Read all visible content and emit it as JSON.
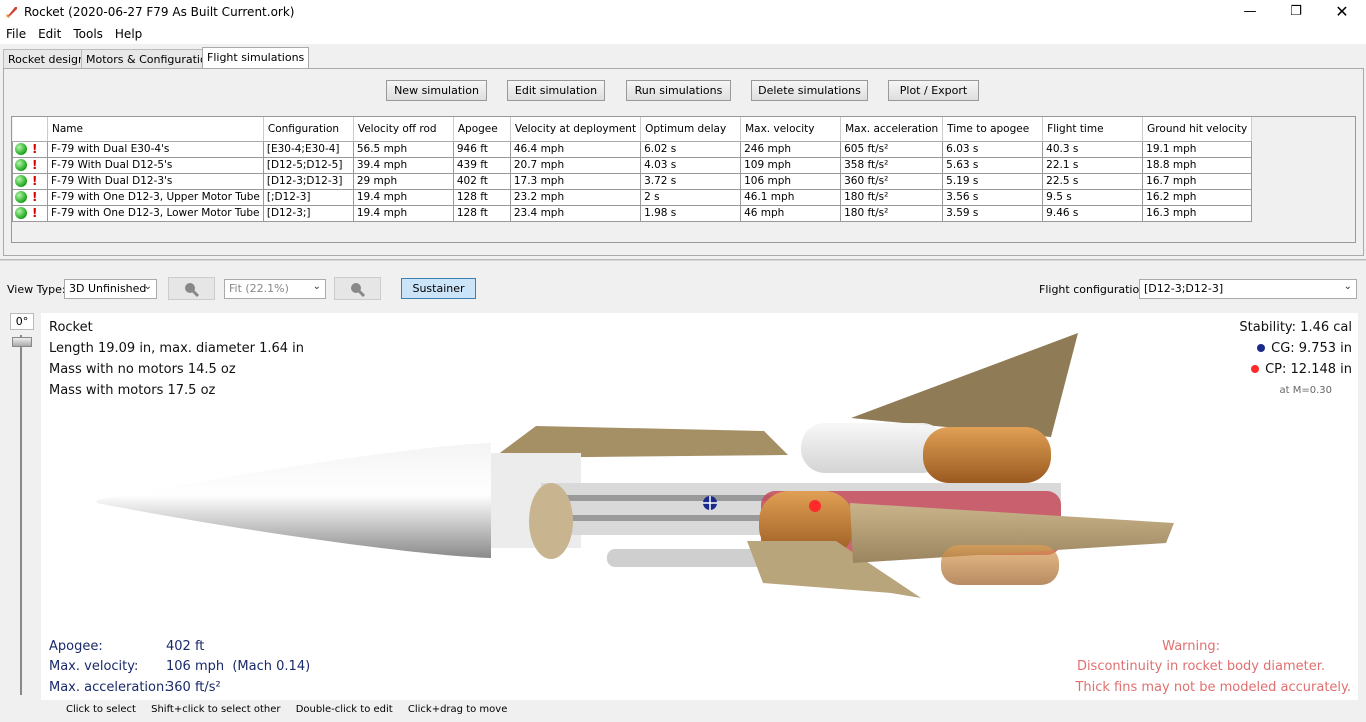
{
  "window": {
    "title": "Rocket (2020-06-27 F79 As Built Current.ork)"
  },
  "menu": [
    "File",
    "Edit",
    "Tools",
    "Help"
  ],
  "tabs": [
    "Rocket design",
    "Motors & Configuration",
    "Flight simulations"
  ],
  "buttons": {
    "new_sim": "New simulation",
    "edit_sim": "Edit simulation",
    "run_sims": "Run simulations",
    "delete_sims": "Delete simulations",
    "plot_export": "Plot / Export"
  },
  "table": {
    "columns": [
      "Name",
      "Configuration",
      "Velocity off rod",
      "Apogee",
      "Velocity at deployment",
      "Optimum delay",
      "Max. velocity",
      "Max. acceleration",
      "Time to apogee",
      "Flight time",
      "Ground hit velocity"
    ],
    "rows": [
      [
        "F-79 with Dual E30-4's",
        "[E30-4;E30-4]",
        "56.5 mph",
        "946 ft",
        "46.4 mph",
        "6.02 s",
        "246 mph",
        "605 ft/s²",
        "6.03 s",
        "40.3 s",
        "19.1 mph"
      ],
      [
        "F-79 With Dual D12-5's",
        "[D12-5;D12-5]",
        "39.4 mph",
        "439 ft",
        "20.7 mph",
        "4.03 s",
        "109 mph",
        "358 ft/s²",
        "5.63 s",
        "22.1 s",
        "18.8 mph"
      ],
      [
        "F-79 With Dual D12-3's",
        "[D12-3;D12-3]",
        "29 mph",
        "402 ft",
        "17.3 mph",
        "3.72 s",
        "106 mph",
        "360 ft/s²",
        "5.19 s",
        "22.5 s",
        "16.7 mph"
      ],
      [
        "F-79 with One D12-3, Upper Motor Tube",
        "[;D12-3]",
        "19.4 mph",
        "128 ft",
        "23.2 mph",
        "2 s",
        "46.1 mph",
        "180 ft/s²",
        "3.56 s",
        "9.5 s",
        "16.2 mph"
      ],
      [
        "F-79 with One D12-3, Lower Motor Tube",
        "[D12-3;]",
        "19.4 mph",
        "128 ft",
        "23.4 mph",
        "1.98 s",
        "46 mph",
        "180 ft/s²",
        "3.59 s",
        "9.46 s",
        "16.3 mph"
      ]
    ]
  },
  "toolbar": {
    "view_type_label": "View Type:",
    "view_type_value": "3D Unfinished",
    "zoom_value": "Fit (22.1%)",
    "sustainer_label": "Sustainer",
    "flight_config_label": "Flight configuration:",
    "flight_config_value": "[D12-3;D12-3]"
  },
  "rotation": "0°",
  "rocket_info": {
    "name": "Rocket",
    "length": "Length 19.09 in, max. diameter 1.64 in",
    "mass_no_motors": "Mass with no motors 14.5 oz",
    "mass_motors": "Mass with motors 17.5 oz"
  },
  "stability": {
    "stability": "Stability:  1.46 cal",
    "cg": "CG:  9.753 in",
    "cp": "CP: 12.148 in",
    "mach": "at M=0.30"
  },
  "flight_summary": {
    "apogee_label": "Apogee:",
    "apogee_value": "402 ft",
    "maxvel_label": "Max. velocity:",
    "maxvel_value": "106 mph  (Mach 0.14)",
    "maxacc_label": "Max. acceleration:",
    "maxacc_value": "360 ft/s²"
  },
  "warnings": [
    "Warning:",
    "Discontinuity in rocket body diameter.",
    "Thick fins may not be modeled accurately."
  ],
  "status_hints": [
    "Click to select",
    "Shift+click to select other",
    "Double-click to edit",
    "Click+drag to move"
  ],
  "colors": {
    "accent_button": "#cce4f7",
    "warning": "#e07070",
    "summary_text": "#1a2a6a"
  }
}
